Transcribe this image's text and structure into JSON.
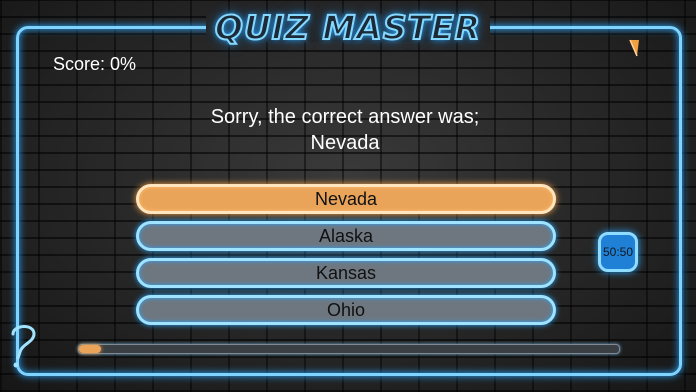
{
  "app": {
    "title": "QUIZ MASTER"
  },
  "score": {
    "text": "Score: 0%"
  },
  "feedback": {
    "line1": "Sorry, the correct answer was;",
    "line2": "Nevada"
  },
  "answers": [
    {
      "label": "Nevada",
      "state": "correct"
    },
    {
      "label": "Alaska",
      "state": "normal"
    },
    {
      "label": "Kansas",
      "state": "normal"
    },
    {
      "label": "Ohio",
      "state": "normal"
    }
  ],
  "lifelines": {
    "fifty_label": "50:50"
  },
  "progress": {
    "fraction": 0.04
  },
  "colors": {
    "neon_blue": "#7fd4ff",
    "correct_orange": "#e9a45a",
    "answer_gray": "#6e7780"
  },
  "icons": {
    "corner": "flag-icon",
    "help": "question-mark-icon"
  }
}
